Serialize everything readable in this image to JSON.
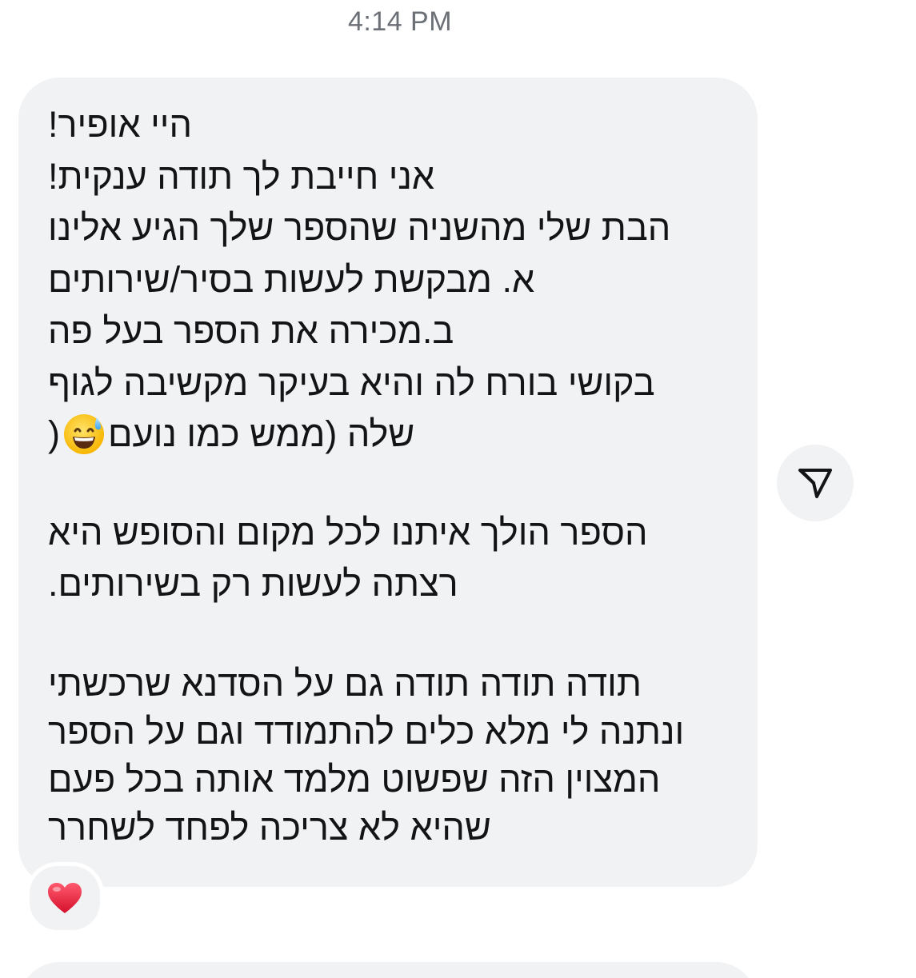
{
  "thread": {
    "timestamp": "4:14 PM"
  },
  "message": {
    "lines": [
      "היי אופיר!",
      "אני חייבת לך תודה ענקית!",
      "הבת שלי מהשניה שהספר שלך הגיע אלינו",
      "א. מבקשת לעשות בסיר/שירותים",
      "ב.מכירה את הספר בעל פה",
      "בקושי בורח לה והיא בעיקר מקשיבה לגוף",
      "",
      "",
      "הספר הולך איתנו לכל מקום והסופש היא",
      "רצתה לעשות רק בשירותים.",
      "",
      "תודה תודה תודה גם על הסדנא שרכשתי",
      "ונתנה לי מלא כלים להתמודד וגם על הספר",
      "המצוין הזה שפשוט מלמד אותה בכל פעם",
      "שהיא לא צריכה לפחד לשחרר"
    ],
    "emoji_line": {
      "open": "שלה (ממש כמו נועם",
      "emoji": "grinning-face-with-sweat-emoji",
      "close": ")"
    },
    "reaction": "heart-emoji"
  },
  "colors": {
    "bubble": "#f1f2f4",
    "text": "#121416",
    "timestamp": "#6b6f76",
    "heart": "#e0203a"
  }
}
